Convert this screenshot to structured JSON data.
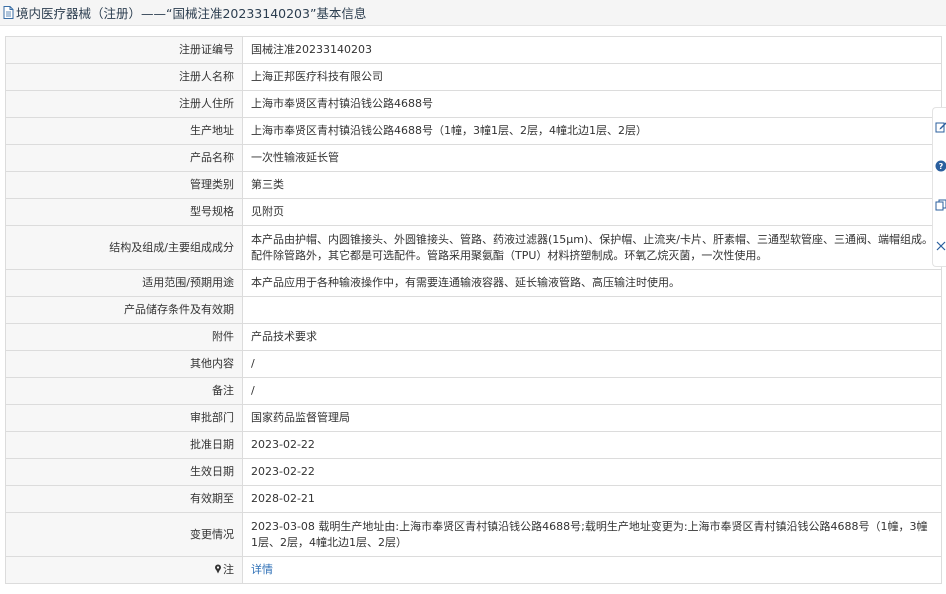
{
  "header": {
    "title": "境内医疗器械（注册）——“国械注准20233140203”基本信息"
  },
  "rows": [
    {
      "label": "注册证编号",
      "value": "国械注准20233140203"
    },
    {
      "label": "注册人名称",
      "value": "上海正邦医疗科技有限公司"
    },
    {
      "label": "注册人住所",
      "value": "上海市奉贤区青村镇沿钱公路4688号"
    },
    {
      "label": "生产地址",
      "value": "上海市奉贤区青村镇沿钱公路4688号（1幢，3幢1层、2层，4幢北边1层、2层）"
    },
    {
      "label": "产品名称",
      "value": "一次性输液延长管"
    },
    {
      "label": "管理类别",
      "value": "第三类"
    },
    {
      "label": "型号规格",
      "value": "见附页"
    },
    {
      "label": "结构及组成/主要组成成分",
      "value": "本产品由护帽、内圆锥接头、外圆锥接头、管路、药液过滤器(15μm)、保护帽、止流夹/卡片、肝素帽、三通型软管座、三通阀、端帽组成。配件除管路外，其它都是可选配件。管路采用聚氨酯（TPU）材料挤塑制成。环氧乙烷灭菌，一次性使用。"
    },
    {
      "label": "适用范围/预期用途",
      "value": "本产品应用于各种输液操作中，有需要连通输液容器、延长输液管路、高压输注时使用。"
    },
    {
      "label": "产品储存条件及有效期",
      "value": ""
    },
    {
      "label": "附件",
      "value": "产品技术要求"
    },
    {
      "label": "其他内容",
      "value": "/"
    },
    {
      "label": "备注",
      "value": "/"
    },
    {
      "label": "审批部门",
      "value": "国家药品监督管理局"
    },
    {
      "label": "批准日期",
      "value": "2023-02-22"
    },
    {
      "label": "生效日期",
      "value": "2023-02-22"
    },
    {
      "label": "有效期至",
      "value": "2028-02-21"
    },
    {
      "label": "变更情况",
      "value": "2023-03-08 载明生产地址由:上海市奉贤区青村镇沿钱公路4688号;载明生产地址变更为:上海市奉贤区青村镇沿钱公路4688号（1幢，3幢1层、2层，4幢北边1层、2层）"
    }
  ],
  "note": {
    "label": "注",
    "link": "详情",
    "icon": "pin-icon"
  },
  "floating_tools": {
    "icons": [
      "edit-icon",
      "help-icon",
      "copy-icon",
      "close-icon"
    ]
  },
  "colors": {
    "link": "#2d6fb6",
    "label_bg": "#f7f7f7",
    "border": "#dcdcdc",
    "help_icon": "#2b5f9e"
  }
}
